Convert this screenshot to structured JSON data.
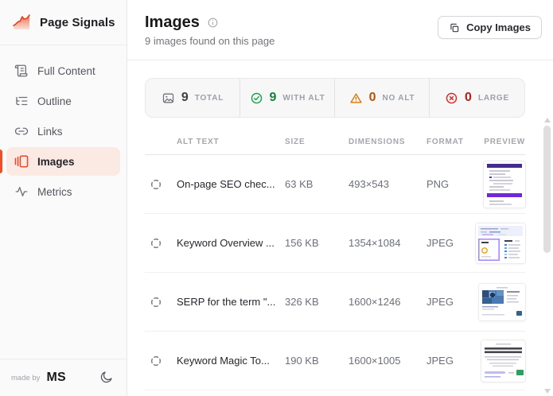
{
  "app": {
    "title": "Page Signals",
    "logo_icon": "area-chart-logo-icon"
  },
  "sidebar": {
    "items": [
      {
        "label": "Full Content",
        "icon": "scroll-text-icon",
        "active": false
      },
      {
        "label": "Outline",
        "icon": "list-tree-icon",
        "active": false
      },
      {
        "label": "Links",
        "icon": "link-icon",
        "active": false
      },
      {
        "label": "Images",
        "icon": "images-gallery-icon",
        "active": true
      },
      {
        "label": "Metrics",
        "icon": "activity-pulse-icon",
        "active": false
      }
    ],
    "footer": {
      "made_by": "made by",
      "author": "MS",
      "theme_icon": "moon-icon"
    }
  },
  "header": {
    "title": "Images",
    "info_icon": "info-icon",
    "subtitle": "9 images found on this page",
    "copy_button": {
      "label": "Copy Images",
      "icon": "copy-icon"
    }
  },
  "stats": [
    {
      "value": "9",
      "label": "TOTAL",
      "icon": "image-icon",
      "color": "#3f3f46"
    },
    {
      "value": "9",
      "label": "WITH ALT",
      "icon": "check-circle-icon",
      "color": "#15803d"
    },
    {
      "value": "0",
      "label": "NO ALT",
      "icon": "warning-triangle-icon",
      "color": "#b45309"
    },
    {
      "value": "0",
      "label": "LARGE",
      "icon": "x-circle-icon",
      "color": "#b91c1c"
    }
  ],
  "table": {
    "columns": [
      "ALT TEXT",
      "SIZE",
      "DIMENSIONS",
      "FORMAT",
      "PREVIEW"
    ],
    "row_icon": "crosshair-locate-icon",
    "rows": [
      {
        "alt_text": "On-page SEO chec...",
        "size": "63 KB",
        "dimensions": "493×543",
        "format": "PNG"
      },
      {
        "alt_text": "Keyword Overview ...",
        "size": "156 KB",
        "dimensions": "1354×1084",
        "format": "JPEG"
      },
      {
        "alt_text": "SERP for the term \"...",
        "size": "326 KB",
        "dimensions": "1600×1246",
        "format": "JPEG"
      },
      {
        "alt_text": "Keyword Magic To...",
        "size": "190 KB",
        "dimensions": "1600×1005",
        "format": "JPEG"
      }
    ]
  },
  "colors": {
    "accent": "#f04f24",
    "active_bg": "#fbe9e3",
    "success": "#16a34a",
    "warning": "#d97706",
    "danger": "#dc2626"
  }
}
